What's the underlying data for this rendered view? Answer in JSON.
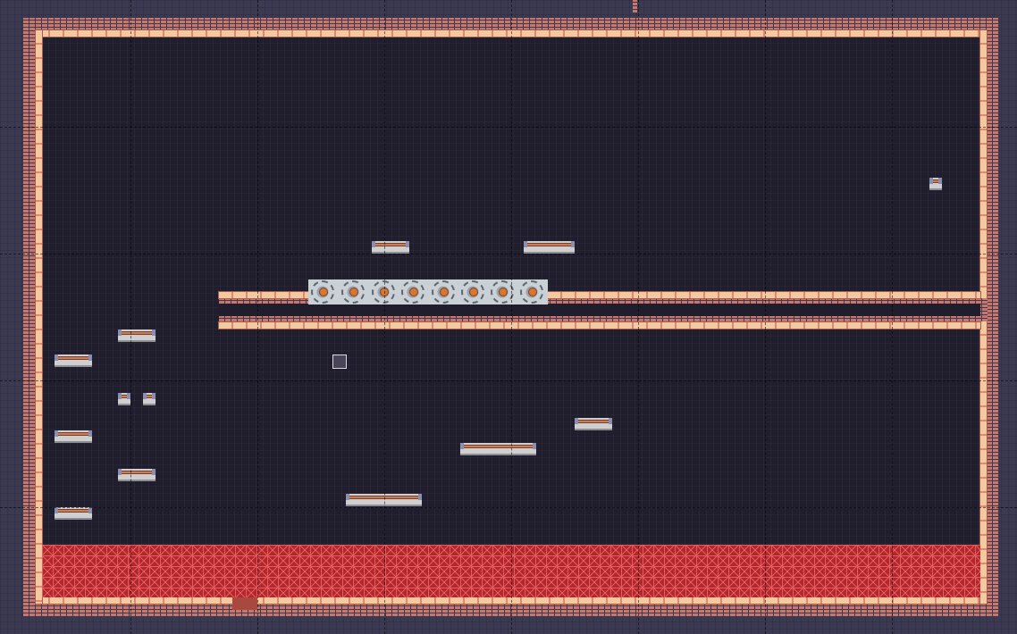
{
  "level": {
    "theme": "brick-dungeon",
    "colors": {
      "outer_background": "#3b3a52",
      "room_background": "#201e2d",
      "brick": "#c9776a",
      "rail": "#f3c9a0",
      "lava": "#b3262c",
      "lava_lines": "#e35e5e",
      "platform": "#cfcfcf",
      "platform_top": "#c87d55",
      "saw": "#c9d1d6"
    },
    "hazards": {
      "lava_pool": "lava-floor",
      "saw_strip": "gear-saw-blades",
      "saw_count": 8
    },
    "player": "player-block",
    "exit": "floor-exit-door",
    "platform_count": 15
  }
}
